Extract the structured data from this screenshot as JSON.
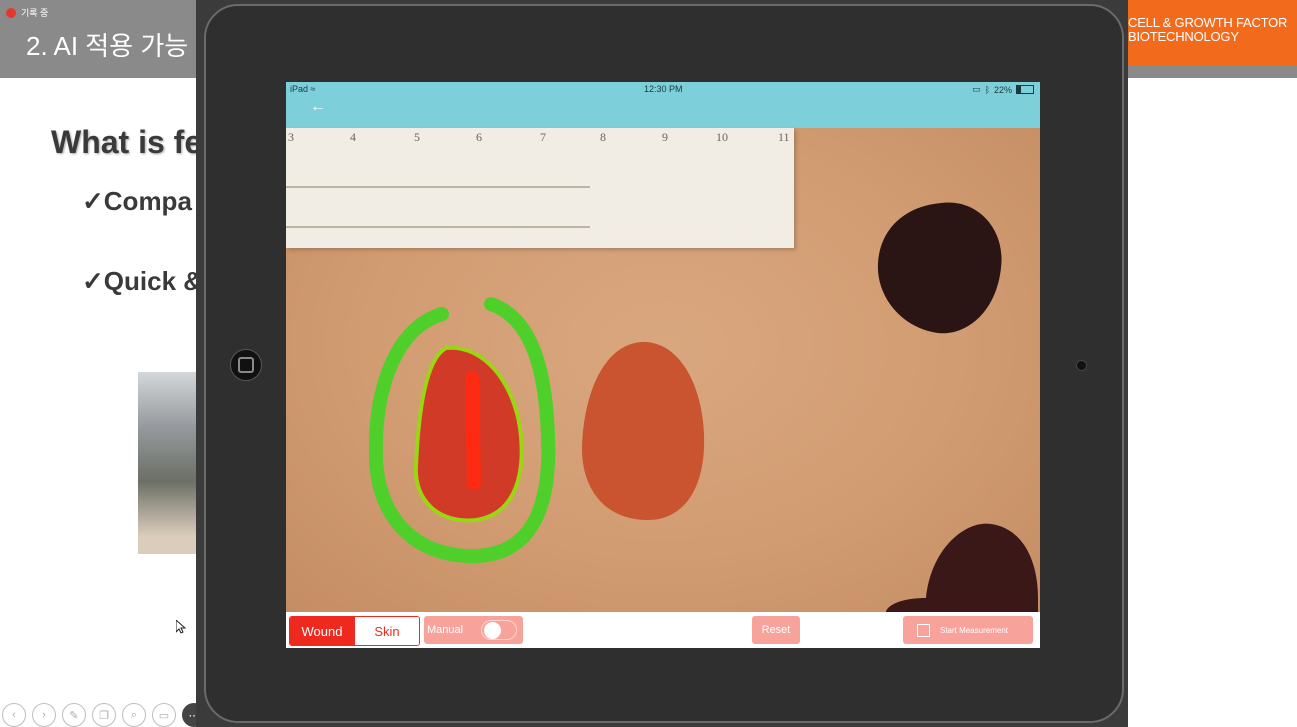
{
  "slide": {
    "recording_label": "기록 중",
    "title": "2. AI 적용 가능",
    "question": "What is fe",
    "bullets": [
      "✓Compa",
      "✓Quick &"
    ],
    "company_lines": [
      "CELL & GROWTH FACTOR",
      "BIOTECHNOLOGY"
    ]
  },
  "presenter_tools": [
    "prev-icon",
    "next-icon",
    "pen-icon",
    "copy-icon",
    "zoom-icon",
    "screen-icon",
    "more-icon"
  ],
  "ipad": {
    "status": {
      "device": "iPad",
      "time": "12:30 PM",
      "battery": "22%"
    },
    "nav": {
      "back_symbol": "←"
    },
    "ruler_ticks": [
      "3",
      "4",
      "5",
      "6",
      "7",
      "8",
      "9",
      "10",
      "11"
    ],
    "controls": {
      "wound_label": "Wound",
      "skin_label": "Skin",
      "manual_label": "Manual",
      "manual_on": false,
      "reset_label": "Reset",
      "start_label": "Start Measurement"
    }
  },
  "colors": {
    "accent_red": "#ee2a1f",
    "button_pink": "#f7a29a",
    "statusbar_teal": "#7dcfd9",
    "brand_orange": "#f26b1d",
    "overlay_green": "#4fcf2a"
  }
}
